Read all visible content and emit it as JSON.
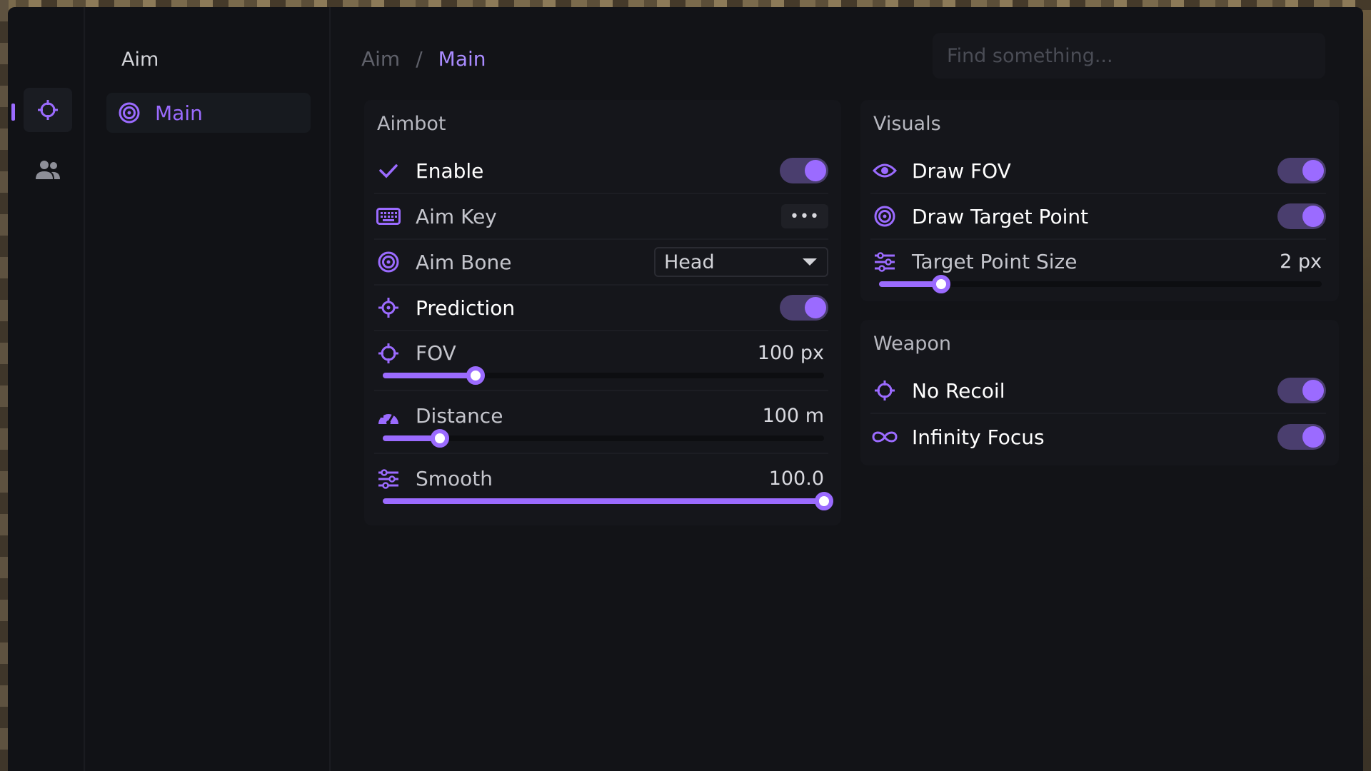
{
  "rail": {
    "items": [
      {
        "icon": "crosshair-icon",
        "active": true
      },
      {
        "icon": "users-icon",
        "active": false
      }
    ]
  },
  "subnav": {
    "title": "Aim",
    "items": [
      {
        "label": "Main",
        "icon": "target-icon",
        "active": true
      }
    ]
  },
  "breadcrumb": {
    "root": "Aim",
    "separator": "/",
    "current": "Main"
  },
  "search": {
    "placeholder": "Find something...",
    "value": ""
  },
  "aimbot": {
    "title": "Aimbot",
    "enable": {
      "label": "Enable",
      "on": true
    },
    "aim_key": {
      "label": "Aim Key",
      "button": "•••"
    },
    "aim_bone": {
      "label": "Aim Bone",
      "selected": "Head"
    },
    "prediction": {
      "label": "Prediction",
      "on": true
    },
    "fov": {
      "label": "FOV",
      "value": "100 px",
      "fraction": 0.21
    },
    "distance": {
      "label": "Distance",
      "value": "100 m",
      "fraction": 0.13
    },
    "smooth": {
      "label": "Smooth",
      "value": "100.0",
      "fraction": 1.0
    }
  },
  "visuals": {
    "title": "Visuals",
    "draw_fov": {
      "label": "Draw FOV",
      "on": true
    },
    "draw_target_point": {
      "label": "Draw Target Point",
      "on": true
    },
    "target_point_size": {
      "label": "Target Point Size",
      "value": "2 px",
      "fraction": 0.14
    }
  },
  "weapon": {
    "title": "Weapon",
    "no_recoil": {
      "label": "No Recoil",
      "on": true
    },
    "infinity_focus": {
      "label": "Infinity Focus",
      "on": true
    }
  },
  "colors": {
    "accent": "#9b6bff",
    "toggle_track": "#4a3e6e",
    "background": "#121317",
    "panel": "#15161b"
  }
}
